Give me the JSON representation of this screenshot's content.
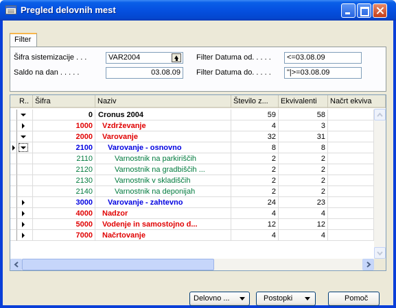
{
  "window": {
    "title": "Pregled delovnih mest"
  },
  "tabs": [
    {
      "label": "Filter"
    }
  ],
  "filter": {
    "sifra_label": "Šifra sistemizacije . . .",
    "sifra_value": "VAR2004",
    "saldo_label": "Saldo na dan . . . . .",
    "saldo_value": "03.08.09",
    "datum_od_label": "Filter Datuma od. . . . .",
    "datum_od_value": "<=03.08.09",
    "datum_do_label": "Filter Datuma do. . . . .",
    "datum_do_value": "\"|>=03.08.09"
  },
  "table": {
    "headers": [
      "R..",
      "Šifra",
      "Naziv",
      "Število z...",
      "Ekvivalenti",
      "Načrt ekviva"
    ],
    "rows": [
      {
        "toggle": "expanded",
        "code": "0",
        "name": "Cronus 2004",
        "stevilo": "59",
        "ekv": "58",
        "color": "#000000",
        "bold": true,
        "indent": 0
      },
      {
        "toggle": "collapsed",
        "code": "1000",
        "name": "Vzdrževanje",
        "stevilo": "4",
        "ekv": "3",
        "color": "#e00000",
        "bold": true,
        "indent": 1
      },
      {
        "toggle": "expanded",
        "code": "2000",
        "name": "Varovanje",
        "stevilo": "32",
        "ekv": "31",
        "color": "#e00000",
        "bold": true,
        "indent": 1
      },
      {
        "toggle": "expanded",
        "code": "2100",
        "name": "Varovanje - osnovno",
        "stevilo": "8",
        "ekv": "8",
        "color": "#0000e0",
        "bold": true,
        "indent": 2,
        "current": true
      },
      {
        "toggle": "",
        "code": "2110",
        "name": "Varnostnik na parkiriščih",
        "stevilo": "2",
        "ekv": "2",
        "color": "#007a3d",
        "bold": false,
        "indent": 3
      },
      {
        "toggle": "",
        "code": "2120",
        "name": "Varnostnik na gradbiščih ...",
        "stevilo": "2",
        "ekv": "2",
        "color": "#007a3d",
        "bold": false,
        "indent": 3
      },
      {
        "toggle": "",
        "code": "2130",
        "name": "Varnostnik v skladiščih",
        "stevilo": "2",
        "ekv": "2",
        "color": "#007a3d",
        "bold": false,
        "indent": 3
      },
      {
        "toggle": "",
        "code": "2140",
        "name": "Varnostnik na deponijah",
        "stevilo": "2",
        "ekv": "2",
        "color": "#007a3d",
        "bold": false,
        "indent": 3
      },
      {
        "toggle": "collapsed",
        "code": "3000",
        "name": "Varovanje - zahtevno",
        "stevilo": "24",
        "ekv": "23",
        "color": "#0000e0",
        "bold": true,
        "indent": 2
      },
      {
        "toggle": "collapsed",
        "code": "4000",
        "name": "Nadzor",
        "stevilo": "4",
        "ekv": "4",
        "color": "#e00000",
        "bold": true,
        "indent": 1
      },
      {
        "toggle": "collapsed",
        "code": "5000",
        "name": "Vodenje in samostojno d...",
        "stevilo": "12",
        "ekv": "12",
        "color": "#e00000",
        "bold": true,
        "indent": 1
      },
      {
        "toggle": "collapsed",
        "code": "7000",
        "name": "Načrtovanje",
        "stevilo": "4",
        "ekv": "4",
        "color": "#e00000",
        "bold": true,
        "indent": 1
      }
    ]
  },
  "buttons": {
    "delovno": "Delovno ...",
    "postopki": "Postopki",
    "pomoc": "Pomoč"
  }
}
